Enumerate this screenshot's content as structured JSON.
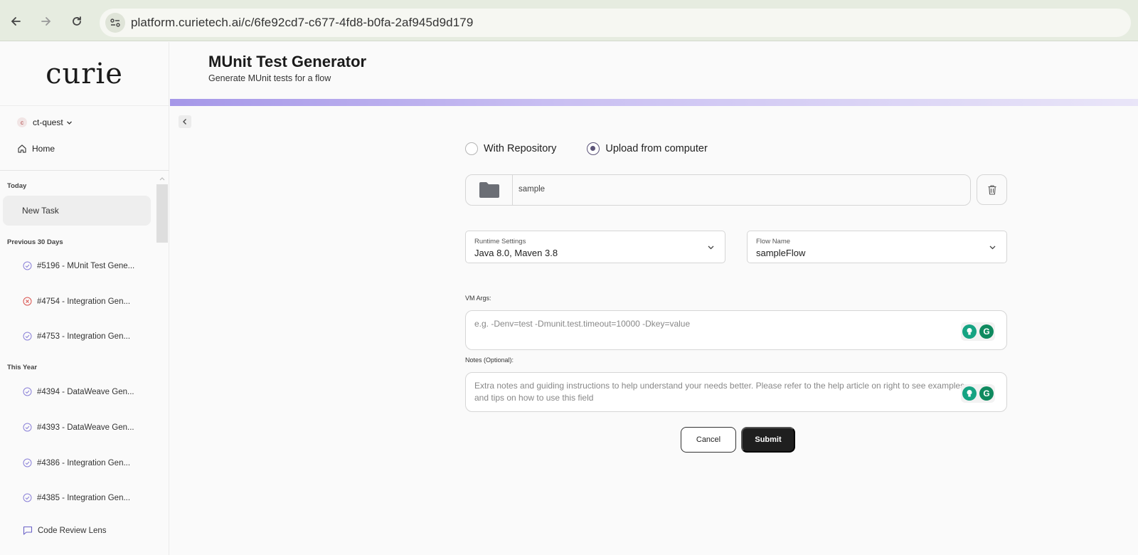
{
  "browser": {
    "url": "platform.curietech.ai/c/6fe92cd7-c677-4fd8-b0fa-2af945d9d179"
  },
  "sidebar": {
    "logo": "curie",
    "workspace": {
      "badge": "c",
      "name": "ct-quest"
    },
    "home_label": "Home",
    "sections": {
      "today": "Today",
      "previous_30": "Previous 30 Days",
      "this_year": "This Year"
    },
    "new_task": "New Task",
    "previous_30_items": [
      {
        "label": "#5196 - MUnit Test Gene...",
        "status": "done"
      },
      {
        "label": "#4754 - Integration Gen...",
        "status": "failed"
      },
      {
        "label": "#4753 - Integration Gen...",
        "status": "done"
      }
    ],
    "this_year_items": [
      {
        "label": "#4394 - DataWeave Gen...",
        "status": "done"
      },
      {
        "label": "#4393 - DataWeave Gen...",
        "status": "done"
      },
      {
        "label": "#4386 - Integration Gen...",
        "status": "done"
      },
      {
        "label": "#4385 - Integration Gen...",
        "status": "done"
      }
    ],
    "code_review": "Code Review Lens"
  },
  "header": {
    "title": "MUnit Test Generator",
    "subtitle": "Generate MUnit tests for a flow"
  },
  "form": {
    "source_options": [
      "With Repository",
      "Upload from computer"
    ],
    "selected_source": "Upload from computer",
    "file_name": "sample",
    "runtime": {
      "label": "Runtime Settings",
      "value": "Java 8.0, Maven 3.8"
    },
    "flow": {
      "label": "Flow Name",
      "value": "sampleFlow"
    },
    "vm_args": {
      "label": "VM Args:",
      "placeholder": "e.g. -Denv=test -Dmunit.test.timeout=10000 -Dkey=value"
    },
    "notes": {
      "label": "Notes (Optional):",
      "placeholder": "Extra notes and guiding instructions to help understand your needs better. Please refer to the help article on right to see examples and tips on how to use this field"
    },
    "cancel_label": "Cancel",
    "submit_label": "Submit"
  },
  "colors": {
    "accent": "#5c5478",
    "gradient_start": "#a597e8",
    "failed": "#d9534f",
    "done": "#8a80d8"
  }
}
